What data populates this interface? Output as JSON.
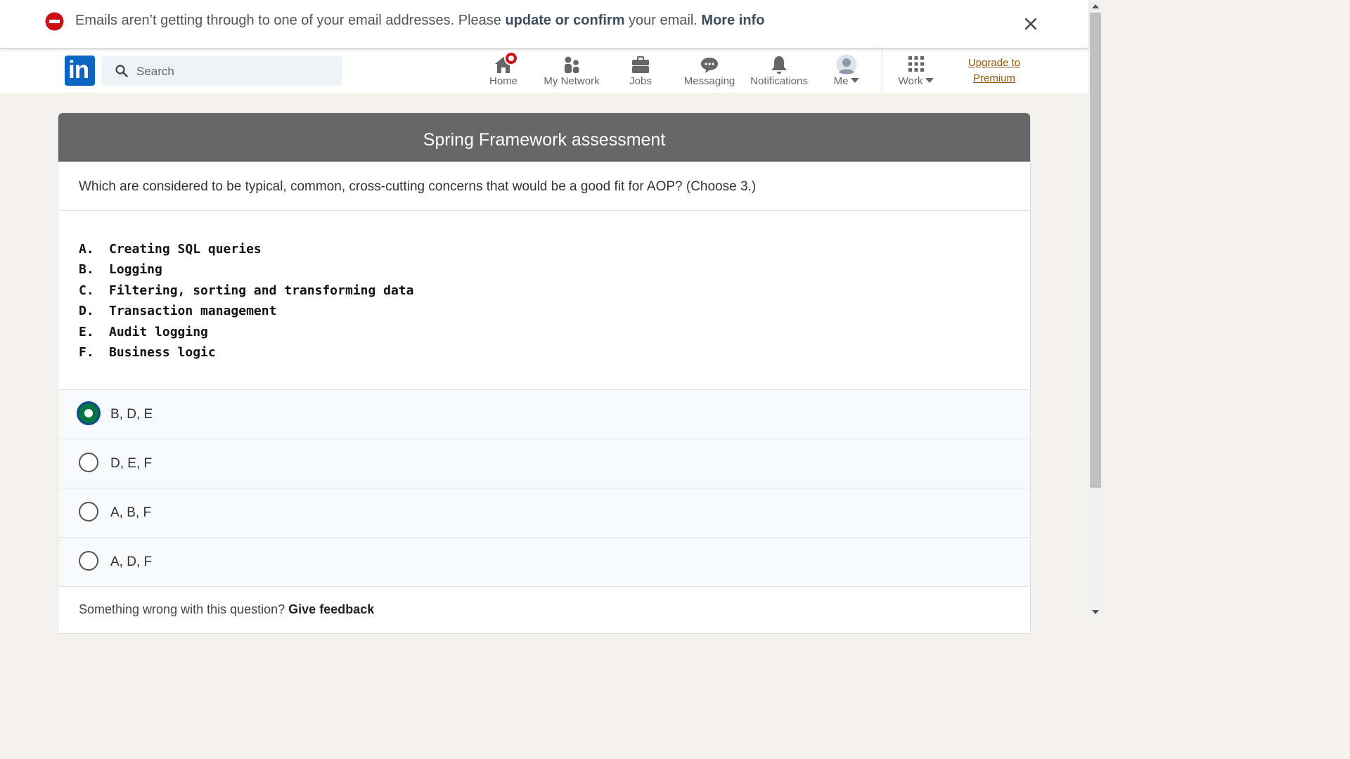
{
  "alert": {
    "text_before": "Emails aren’t getting through to one of your email addresses. Please ",
    "link_update": "update or confirm",
    "text_middle": " your email. ",
    "link_more": "More info"
  },
  "nav": {
    "logo": "in",
    "search_placeholder": "Search",
    "items": [
      {
        "label": "Home",
        "icon": "home-icon"
      },
      {
        "label": "My Network",
        "icon": "network-icon"
      },
      {
        "label": "Jobs",
        "icon": "briefcase-icon"
      },
      {
        "label": "Messaging",
        "icon": "messaging-icon"
      },
      {
        "label": "Notifications",
        "icon": "bell-icon"
      },
      {
        "label": "Me",
        "icon": "avatar"
      },
      {
        "label": "Work",
        "icon": "grid-icon"
      }
    ],
    "premium_line1": "Upgrade to",
    "premium_line2": "Premium"
  },
  "assessment": {
    "title": "Spring Framework assessment",
    "question": "Which are considered to be typical, common, cross-cutting concerns that would be a good fit for AOP? (Choose 3.)",
    "code_lines": [
      {
        "letter": "A.",
        "text": "Creating SQL queries"
      },
      {
        "letter": "B.",
        "text": "Logging"
      },
      {
        "letter": "C.",
        "text": "Filtering, sorting and transforming data"
      },
      {
        "letter": "D.",
        "text": "Transaction management"
      },
      {
        "letter": "E.",
        "text": "Audit logging"
      },
      {
        "letter": "F.",
        "text": "Business logic"
      }
    ],
    "options": [
      {
        "label": "B, D, E",
        "selected": true
      },
      {
        "label": "D, E, F",
        "selected": false
      },
      {
        "label": "A, B, F",
        "selected": false
      },
      {
        "label": "A, D, F",
        "selected": false
      }
    ],
    "feedback_text": "Something wrong with this question? ",
    "feedback_link": "Give feedback"
  },
  "colors": {
    "brand": "#0a66c2",
    "header_bg": "#666666",
    "selected": "#057642",
    "premium": "#915907",
    "alert_icon": "#cc1016"
  }
}
